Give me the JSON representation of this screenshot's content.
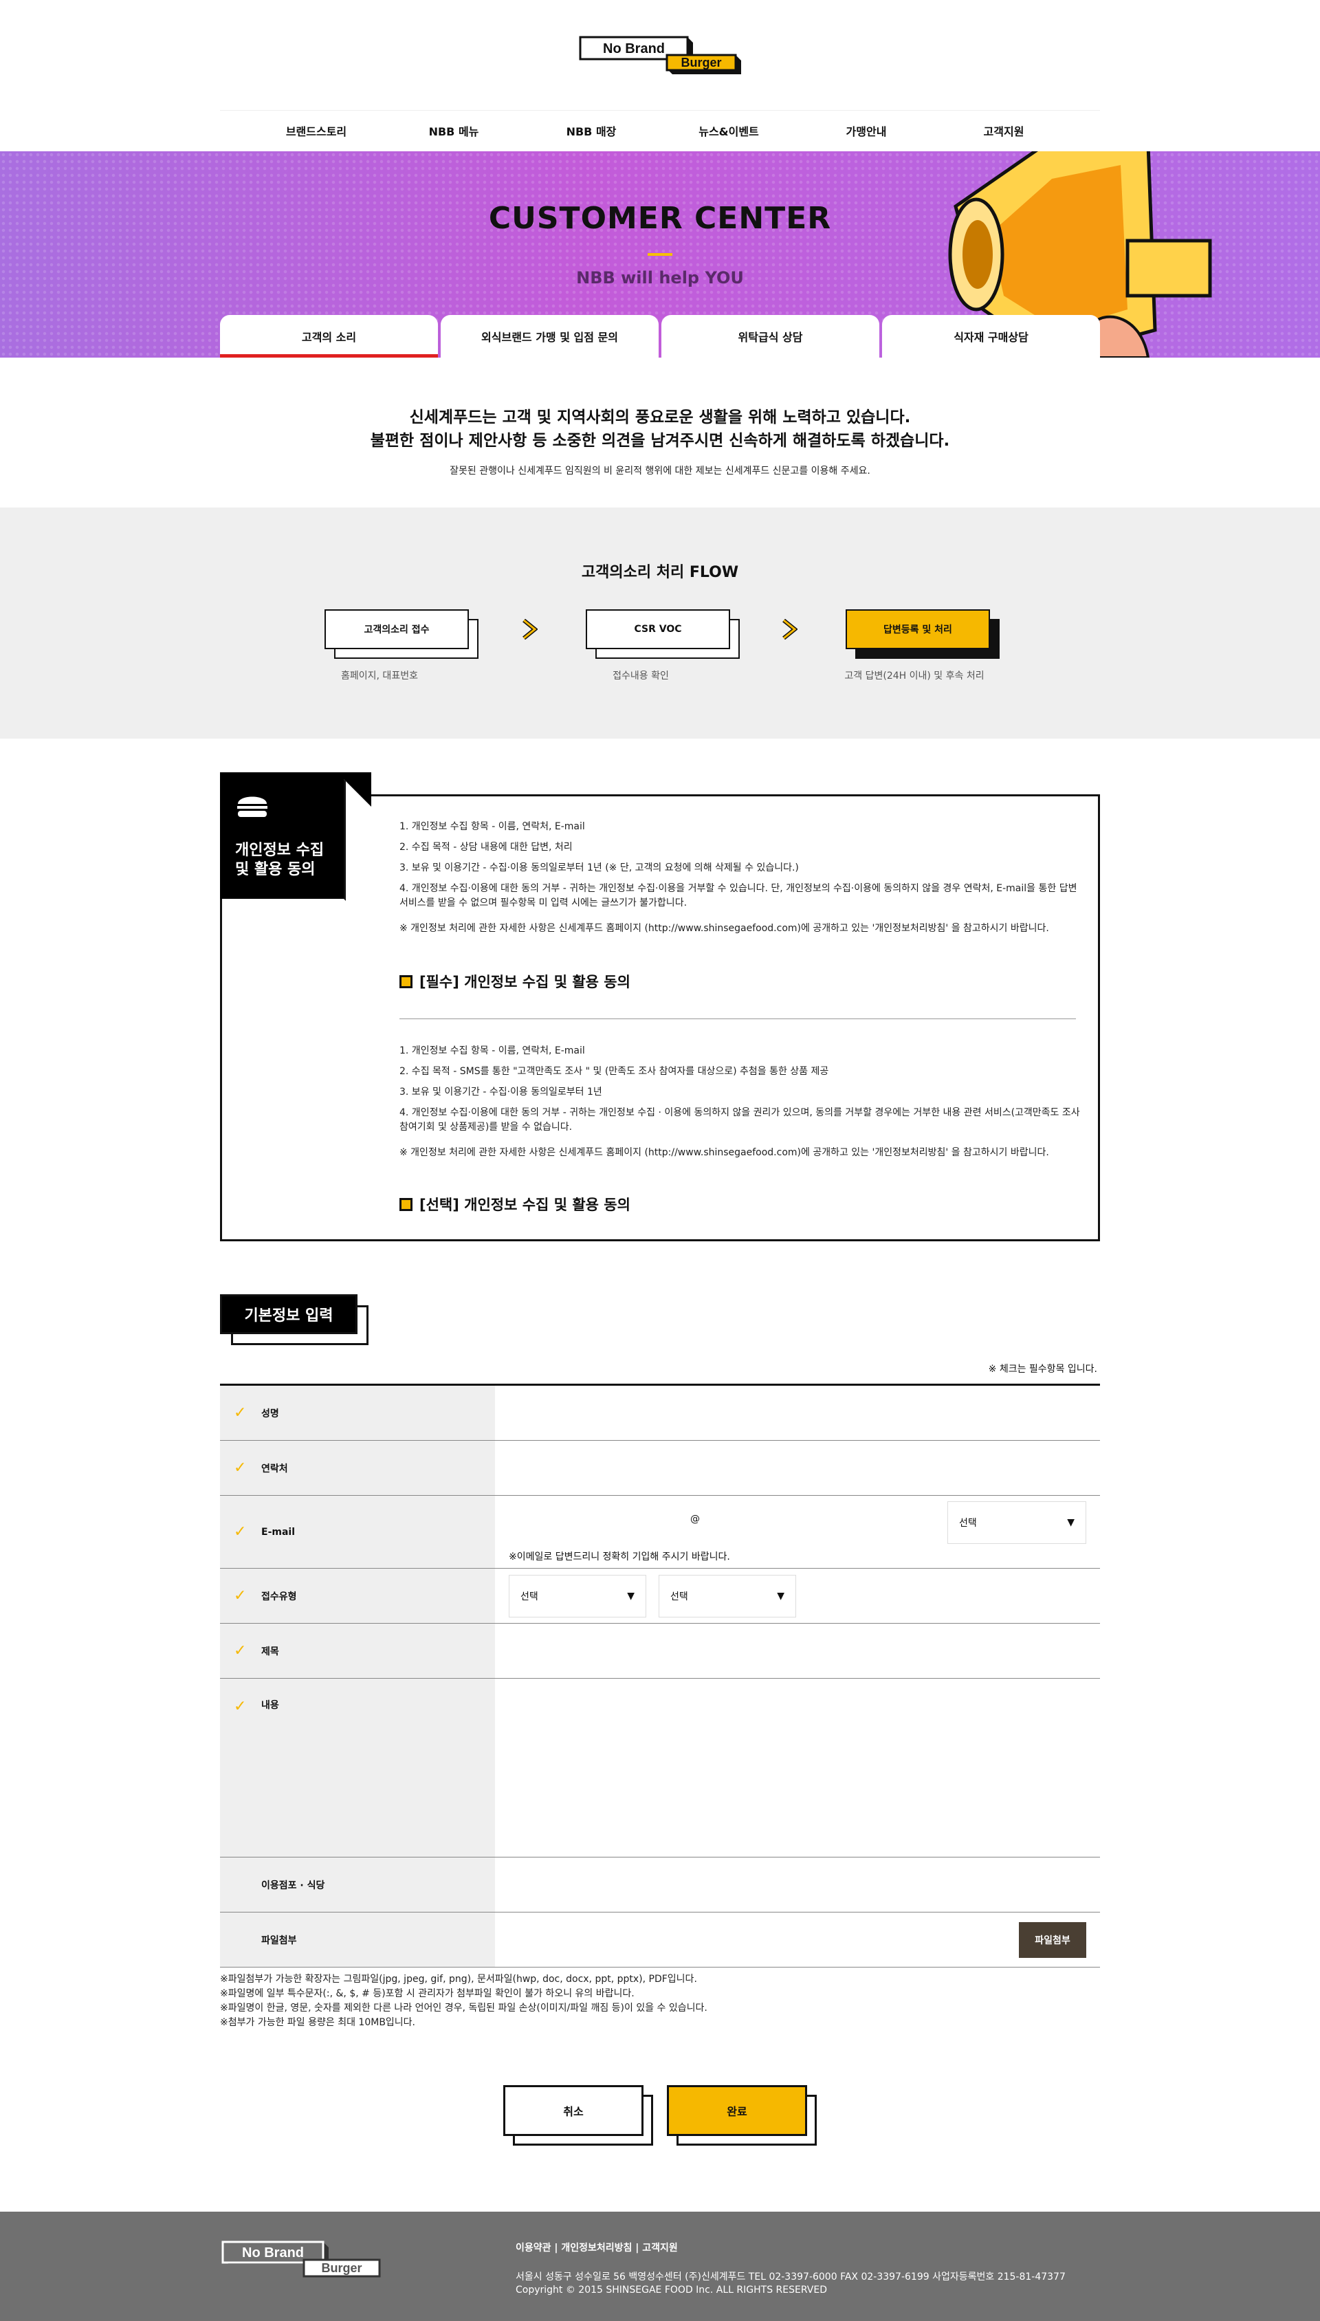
{
  "brand": {
    "logo_top": "No Brand",
    "logo_bottom": "Burger"
  },
  "nav": [
    "브랜드스토리",
    "NBB 메뉴",
    "NBB 매장",
    "뉴스&이벤트",
    "가맹안내",
    "고객지원"
  ],
  "hero": {
    "title": "CUSTOMER CENTER",
    "subtitle": "NBB will help YOU",
    "tabs": [
      "고객의 소리",
      "외식브랜드 가맹 및 입점 문의",
      "위탁급식 상담",
      "식자재 구매상담"
    ]
  },
  "intro": {
    "line1": "신세계푸드는 고객 및 지역사회의 풍요로운 생활을 위해 노력하고 있습니다.",
    "line2": "불편한 점이나 제안사항 등 소중한 의견을 남겨주시면 신속하게 해결하도록 하겠습니다.",
    "note": "잘못된 관행이나 신세계푸드 임직원의 비 윤리적 행위에 대한 제보는 신세계푸드 신문고를 이용해 주세요."
  },
  "flow": {
    "title": "고객의소리 처리 FLOW",
    "steps": [
      {
        "label": "고객의소리 접수",
        "caption": "홈페이지, 대표번호"
      },
      {
        "label": "CSR VOC",
        "caption": "접수내용 확인"
      },
      {
        "label": "답변등록 및 처리",
        "caption": "고객 답변(24H 이내) 및 후속 처리"
      }
    ]
  },
  "consent": {
    "title_l1": "개인정보 수집",
    "title_l2": "및 활용 동의",
    "required": {
      "items": [
        "1. 개인정보 수집 항목  - 이름, 연락처, E-mail",
        "2. 수집 목적  - 상담 내용에 대한 답변, 처리",
        "3. 보유 및 이용기간  - 수집·이용 동의일로부터 1년 (※ 단, 고객의 요청에 의해 삭제될 수 있습니다.)",
        "4. 개인정보 수집·이용에 대한 동의 거부  - 귀하는 개인정보 수집·이용을 거부할 수 있습니다. 단, 개인정보의 수집·이용에 동의하지 않을 경우 연락처, E-mail을 통한 답변 서비스를 받을 수 없으며 필수항목 미 입력 시에는 글쓰기가 불가합니다.",
        "※ 개인정보 처리에 관한 자세한 사항은 신세계푸드 홈페이지 (http://www.shinsegaefood.com)에 공개하고 있는 '개인정보처리방침' 을 참고하시기 바랍니다."
      ],
      "check": "[필수] 개인정보 수집 및 활용 동의"
    },
    "optional": {
      "items": [
        "1. 개인정보 수집 항목  - 이름, 연락처, E-mail",
        "2. 수집 목적  - SMS를 통한 \"고객만족도 조사 \" 및 (만족도 조사 참여자를 대상으로) 추첨을 통한 상품 제공",
        "3. 보유 및 이용기간  - 수집·이용 동의일로부터 1년",
        "4. 개인정보 수집·이용에 대한 동의 거부  - 귀하는 개인정보 수집 · 이용에 동의하지 않을 권리가 있으며, 동의를 거부할 경우에는 거부한 내용 관련 서비스(고객만족도 조사 참여기회 및 상품제공)를 받을 수 없습니다.",
        "※ 개인정보 처리에 관한 자세한 사항은 신세계푸드 홈페이지 (http://www.shinsegaefood.com)에 공개하고 있는 '개인정보처리방침' 을 참고하시기 바랍니다."
      ],
      "check": "[선택] 개인정보 수집 및 활용 동의"
    }
  },
  "form": {
    "section_title": "기본정보 입력",
    "required_note": "※ 체크는 필수항목 입니다.",
    "labels": {
      "name": "성명",
      "phone": "연락처",
      "email": "E-mail",
      "type": "접수유형",
      "subject": "제목",
      "content": "내용",
      "store": "이용점포 · 식당",
      "file": "파일첨부"
    },
    "email_at": "@",
    "select_text": "선택",
    "email_note": "※이메일로 답변드리니 정확히 기입해 주시기 바랍니다.",
    "file_button": "파일첨부",
    "notes": [
      "※파일첨부가 가능한 확장자는 그림파일(jpg, jpeg, gif, png), 문서파일(hwp, doc, docx, ppt, pptx), PDF입니다.",
      "※파일명에 일부 특수문자(:, &, $, # 등)포함 시 관리자가 첨부파일 확인이 불가 하오니 유의 바랍니다.",
      "※파일명이 한글, 영문, 숫자를 제외한 다른 나라 언어인 경우, 독립된 파일 손상(이미지/파일 깨짐 등)이 있을 수 있습니다.",
      "※첨부가 가능한 파일 용량은 최대 10MB입니다."
    ],
    "cancel": "취소",
    "submit": "완료"
  },
  "footer": {
    "links": "이용약관 | 개인정보처리방침 | 고객지원",
    "address": "서울시 성동구 성수일로 56 백영성수센터 (주)신세계푸드  TEL 02-3397-6000  FAX 02-3397-6199  사업자등록번호 215-81-47377",
    "copyright": "Copyright © 2015 SHINSEGAE FOOD Inc. ALL RIGHTS RESERVED"
  },
  "colors": {
    "accent": "#f6b800",
    "purple": "#b866de",
    "dark": "#111111",
    "footer": "#707070"
  }
}
